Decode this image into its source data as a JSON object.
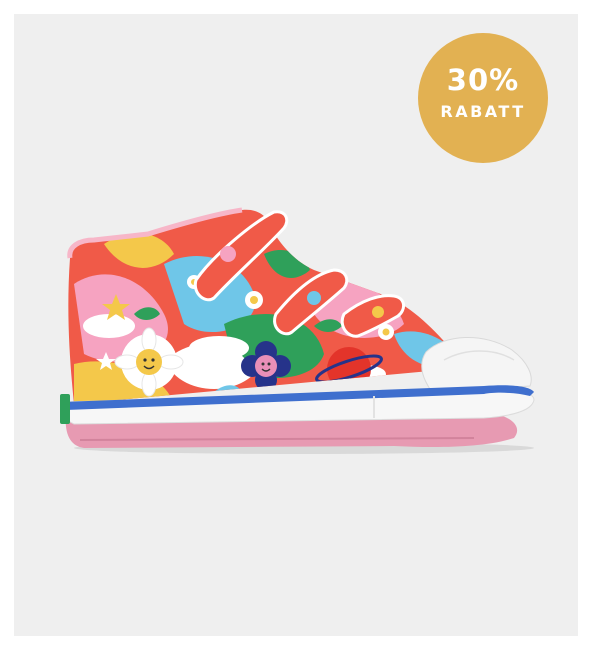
{
  "product": {
    "image_icon": "kids-high-top-sneaker-floral-print",
    "colors": {
      "background": "#efefef",
      "badge": "#e2b152",
      "sole_stripe": "#3f6fce",
      "outsole": "#e79ab2",
      "upper_base": "#f05a48"
    }
  },
  "discount_badge": {
    "percent": "30%",
    "label": "RABATT"
  }
}
